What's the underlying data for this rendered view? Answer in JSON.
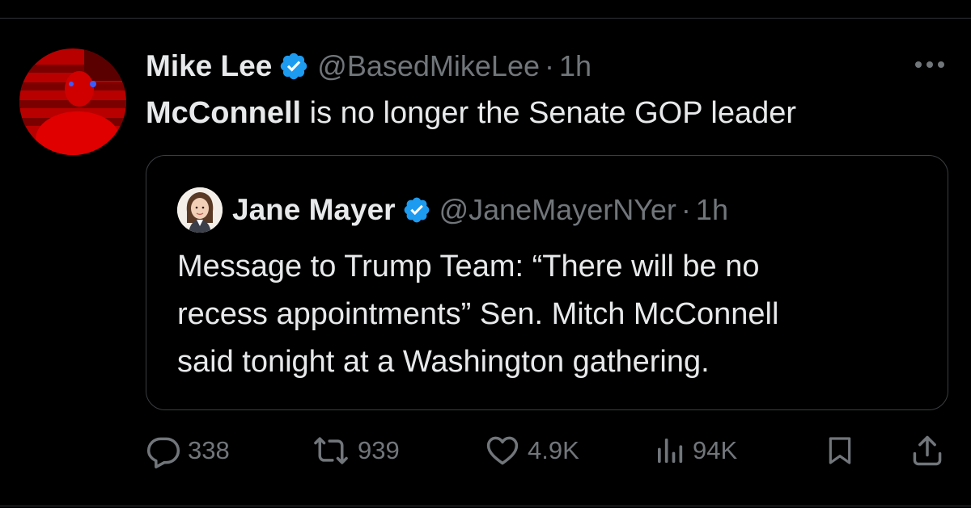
{
  "tweet": {
    "author_name": "Mike Lee",
    "author_handle": "@BasedMikeLee",
    "separator": "·",
    "time": "1h",
    "text_bold": "McConnell",
    "text_rest": " is no longer the Senate GOP leader"
  },
  "quoted_tweet": {
    "author_name": "Jane Mayer",
    "author_handle": "@JaneMayerNYer",
    "separator": "·",
    "time": "1h",
    "lines": [
      "Message to Trump Team: “There will be no",
      "recess appointments” Sen. Mitch McConnell",
      "said tonight at a Washington gathering."
    ]
  },
  "actions": {
    "replies": "338",
    "reposts": "939",
    "likes": "4.9K",
    "views": "94K"
  },
  "icons": {
    "verified": "verified-badge-icon",
    "more": "more-horizontal-icon",
    "reply": "reply-icon",
    "repost": "repost-icon",
    "like": "heart-icon",
    "views": "views-bar-chart-icon",
    "bookmark": "bookmark-icon",
    "share": "share-icon"
  },
  "colors": {
    "background": "#000000",
    "text": "#e7e9ea",
    "secondary_text": "#71767b",
    "verified_blue": "#1d9bf0",
    "border": "#3a3d40"
  }
}
